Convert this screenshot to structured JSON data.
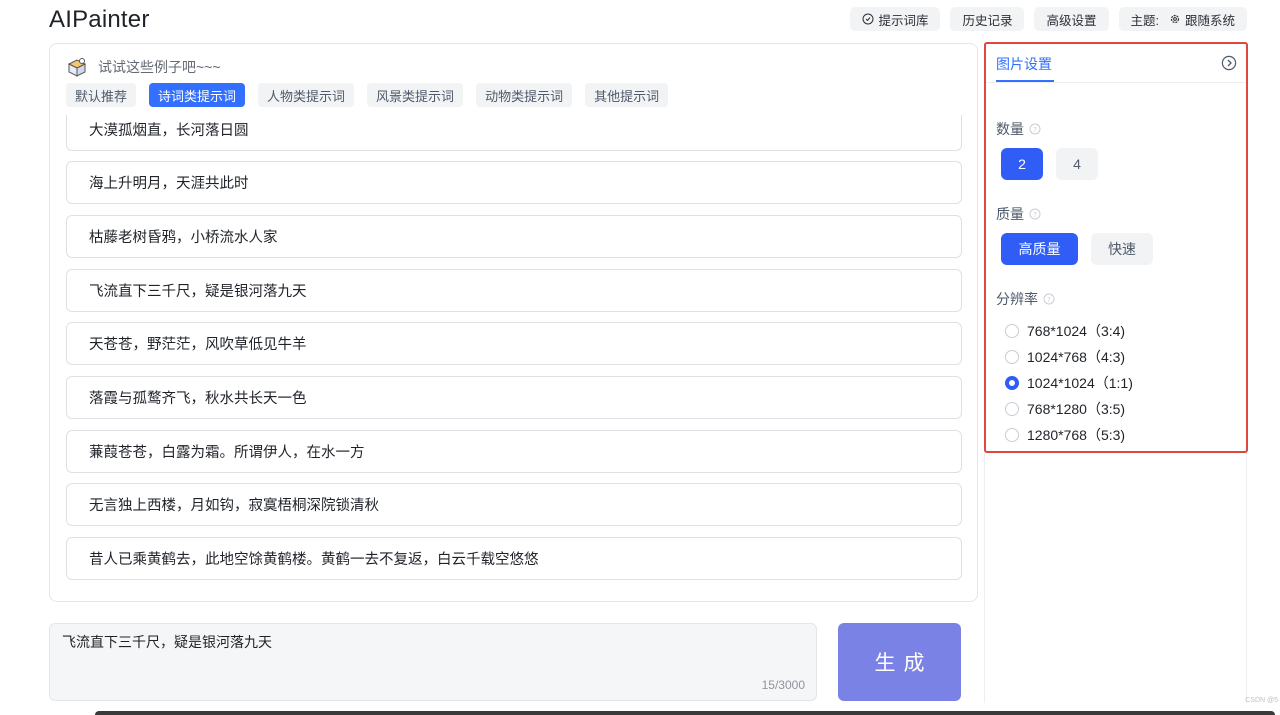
{
  "app": {
    "title": "AIPainter"
  },
  "nav": {
    "prompt_library": "提示词库",
    "history": "历史记录",
    "advanced": "高级设置",
    "theme_label": "主题:",
    "theme_value": "跟随系统"
  },
  "examples": {
    "title": "试试这些例子吧~~~",
    "tabs": [
      "默认推荐",
      "诗词类提示词",
      "人物类提示词",
      "风景类提示词",
      "动物类提示词",
      "其他提示词"
    ],
    "active_tab": "诗词类提示词",
    "items": [
      "大漠孤烟直，长河落日圆",
      "海上升明月，天涯共此时",
      "枯藤老树昏鸦，小桥流水人家",
      "飞流直下三千尺，疑是银河落九天",
      "天苍苍，野茫茫，风吹草低见牛羊",
      "落霞与孤鹜齐飞，秋水共长天一色",
      "蒹葭苍苍，白露为霜。所谓伊人，在水一方",
      "无言独上西楼，月如钩，寂寞梧桐深院锁清秋",
      "昔人已乘黄鹤去，此地空馀黄鹤楼。黄鹤一去不复返，白云千载空悠悠"
    ]
  },
  "input": {
    "value": "飞流直下三千尺，疑是银河落九天",
    "count": "15/3000"
  },
  "generate": {
    "label": "生成"
  },
  "settings": {
    "tab": "图片设置",
    "quantity": {
      "label": "数量",
      "options": [
        "2",
        "4"
      ],
      "selected": "2"
    },
    "quality": {
      "label": "质量",
      "options": [
        "高质量",
        "快速"
      ],
      "selected": "高质量"
    },
    "resolution": {
      "label": "分辨率",
      "options": [
        "768*1024（3:4)",
        "1024*768（4:3)",
        "1024*1024（1:1)",
        "768*1280（3:5)",
        "1280*768（5:3)"
      ],
      "selected_index": 2
    }
  },
  "colors": {
    "accent": "#3370ff",
    "generate": "#7b82e6",
    "highlight": "#e0473e"
  },
  "watermark": "CSDN @5"
}
